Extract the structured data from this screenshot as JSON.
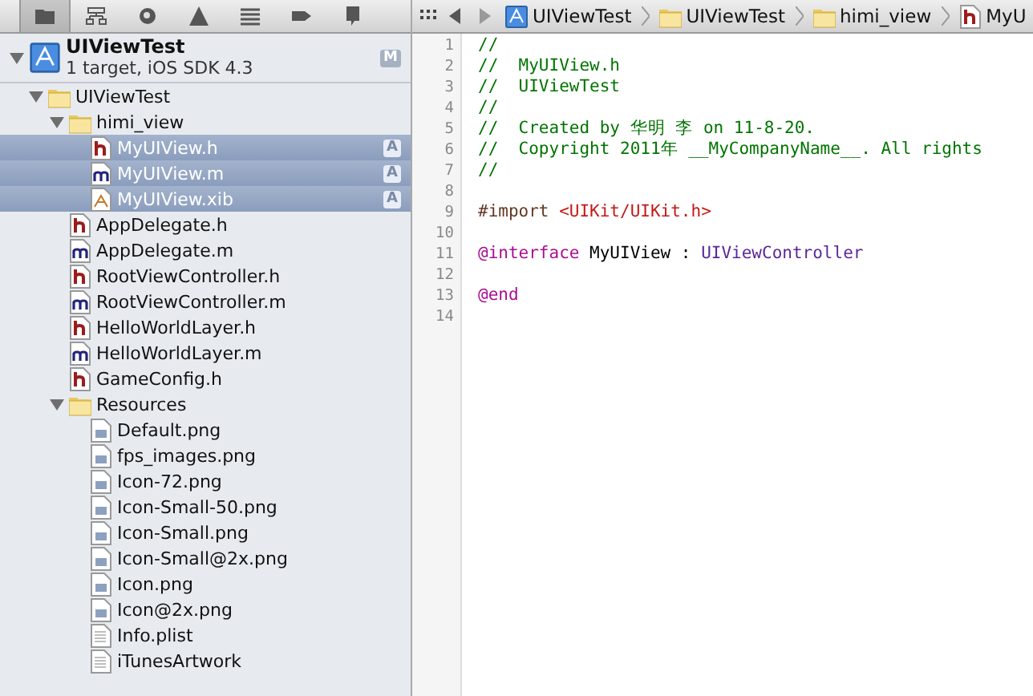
{
  "navigator_tabs": [
    {
      "kind": "folder",
      "selected": true
    },
    {
      "kind": "hierarchy",
      "selected": false
    },
    {
      "kind": "search",
      "selected": false
    },
    {
      "kind": "warning",
      "selected": false
    },
    {
      "kind": "list",
      "selected": false
    },
    {
      "kind": "breakpoint",
      "selected": false
    },
    {
      "kind": "log",
      "selected": false
    }
  ],
  "project": {
    "name": "UIViewTest",
    "subtitle": "1 target, iOS SDK 4.3",
    "badge": "M",
    "expanded": true
  },
  "tree": [
    {
      "kind": "folder",
      "name": "UIViewTest",
      "expanded": true,
      "selected": false,
      "children": [
        {
          "kind": "folder",
          "name": "himi_view",
          "expanded": true,
          "selected": false,
          "children": [
            {
              "kind": "h",
              "name": "MyUIView.h",
              "selected": true,
              "badge": "A"
            },
            {
              "kind": "m",
              "name": "MyUIView.m",
              "selected": true,
              "badge": "A"
            },
            {
              "kind": "xib",
              "name": "MyUIView.xib",
              "selected": true,
              "badge": "A"
            }
          ]
        },
        {
          "kind": "h",
          "name": "AppDelegate.h",
          "selected": false
        },
        {
          "kind": "m",
          "name": "AppDelegate.m",
          "selected": false
        },
        {
          "kind": "h",
          "name": "RootViewController.h",
          "selected": false
        },
        {
          "kind": "m",
          "name": "RootViewController.m",
          "selected": false
        },
        {
          "kind": "h",
          "name": "HelloWorldLayer.h",
          "selected": false
        },
        {
          "kind": "m",
          "name": "HelloWorldLayer.m",
          "selected": false
        },
        {
          "kind": "h",
          "name": "GameConfig.h",
          "selected": false
        },
        {
          "kind": "folder",
          "name": "Resources",
          "expanded": true,
          "selected": false,
          "children": [
            {
              "kind": "png",
              "name": "Default.png",
              "selected": false
            },
            {
              "kind": "png",
              "name": "fps_images.png",
              "selected": false
            },
            {
              "kind": "png",
              "name": "Icon-72.png",
              "selected": false
            },
            {
              "kind": "png",
              "name": "Icon-Small-50.png",
              "selected": false
            },
            {
              "kind": "png",
              "name": "Icon-Small.png",
              "selected": false
            },
            {
              "kind": "png",
              "name": "Icon-Small@2x.png",
              "selected": false
            },
            {
              "kind": "png",
              "name": "Icon.png",
              "selected": false
            },
            {
              "kind": "png",
              "name": "Icon@2x.png",
              "selected": false
            },
            {
              "kind": "plist",
              "name": "Info.plist",
              "selected": false
            },
            {
              "kind": "plist",
              "name": "iTunesArtwork",
              "selected": false
            }
          ]
        }
      ]
    }
  ],
  "breadcrumb": [
    {
      "kind": "project",
      "label": "UIViewTest"
    },
    {
      "kind": "folder",
      "label": "UIViewTest"
    },
    {
      "kind": "folder",
      "label": "himi_view"
    },
    {
      "kind": "h",
      "label": "MyU"
    }
  ],
  "code_lines": [
    {
      "number": "1",
      "segments": [
        {
          "kind": "comment",
          "text": "//"
        }
      ]
    },
    {
      "number": "2",
      "segments": [
        {
          "kind": "comment",
          "text": "//  MyUIView.h"
        }
      ]
    },
    {
      "number": "3",
      "segments": [
        {
          "kind": "comment",
          "text": "//  UIViewTest"
        }
      ]
    },
    {
      "number": "4",
      "segments": [
        {
          "kind": "comment",
          "text": "//"
        }
      ]
    },
    {
      "number": "5",
      "segments": [
        {
          "kind": "comment",
          "text": "//  Created by 华明 李 on 11-8-20."
        }
      ]
    },
    {
      "number": "6",
      "segments": [
        {
          "kind": "comment",
          "text": "//  Copyright 2011年 __MyCompanyName__. All rights"
        }
      ]
    },
    {
      "number": "7",
      "segments": [
        {
          "kind": "comment",
          "text": "//"
        }
      ]
    },
    {
      "number": "8"
    },
    {
      "number": "9",
      "segments": [
        {
          "kind": "directive",
          "text": "#import "
        },
        {
          "kind": "string",
          "text": "<UIKit/UIKit.h>"
        }
      ]
    },
    {
      "number": "10"
    },
    {
      "number": "11",
      "segments": [
        {
          "kind": "keyword",
          "text": "@interface"
        },
        {
          "kind": "plain",
          "text": " MyUIView : "
        },
        {
          "kind": "type",
          "text": "UIViewController"
        }
      ]
    },
    {
      "number": "12"
    },
    {
      "number": "13",
      "segments": [
        {
          "kind": "keyword",
          "text": "@end"
        }
      ]
    },
    {
      "number": "14"
    }
  ]
}
